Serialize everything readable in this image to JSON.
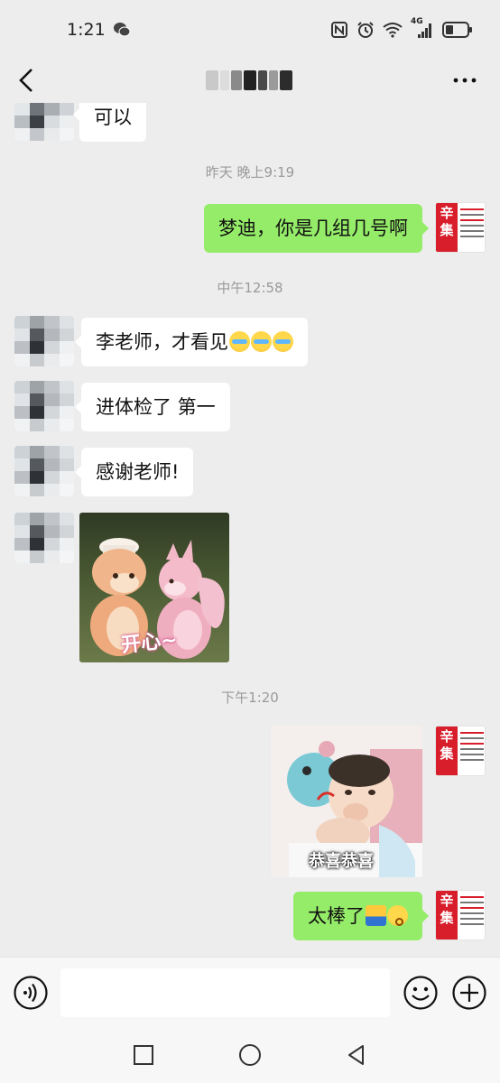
{
  "status_bar": {
    "time": "1:21",
    "network_label": "4G"
  },
  "nav": {
    "title_hidden": true
  },
  "input": {
    "placeholder": "",
    "value": ""
  },
  "messages": {
    "m0_text": "可以",
    "t1": "昨天 晚上9:19",
    "m1_text": "梦迪，你是几组几号啊",
    "t2": "中午12:58",
    "m2_text": "李老师，才看见",
    "m3_text": "进体检了 第一",
    "m4_text": "感谢老师!",
    "m5_caption": "开心~",
    "t3": "下午1:20",
    "m6_caption": "恭喜恭喜",
    "m7_text": "太棒了"
  },
  "my_avatar": {
    "brand_chars": "辛集"
  },
  "colors": {
    "background": "#ededed",
    "outgoing_bubble": "#95ec69",
    "incoming_bubble": "#ffffff",
    "time_label": "#9a9a9a",
    "brand_red": "#d81e2b"
  },
  "icons": [
    "wechat-icon",
    "nfc-icon",
    "alarm-icon",
    "wifi-icon",
    "signal-icon",
    "battery-icon",
    "back-icon",
    "more-icon",
    "voice-icon",
    "emoji-icon",
    "plus-icon",
    "recents-icon",
    "home-icon",
    "back-nav-icon"
  ]
}
